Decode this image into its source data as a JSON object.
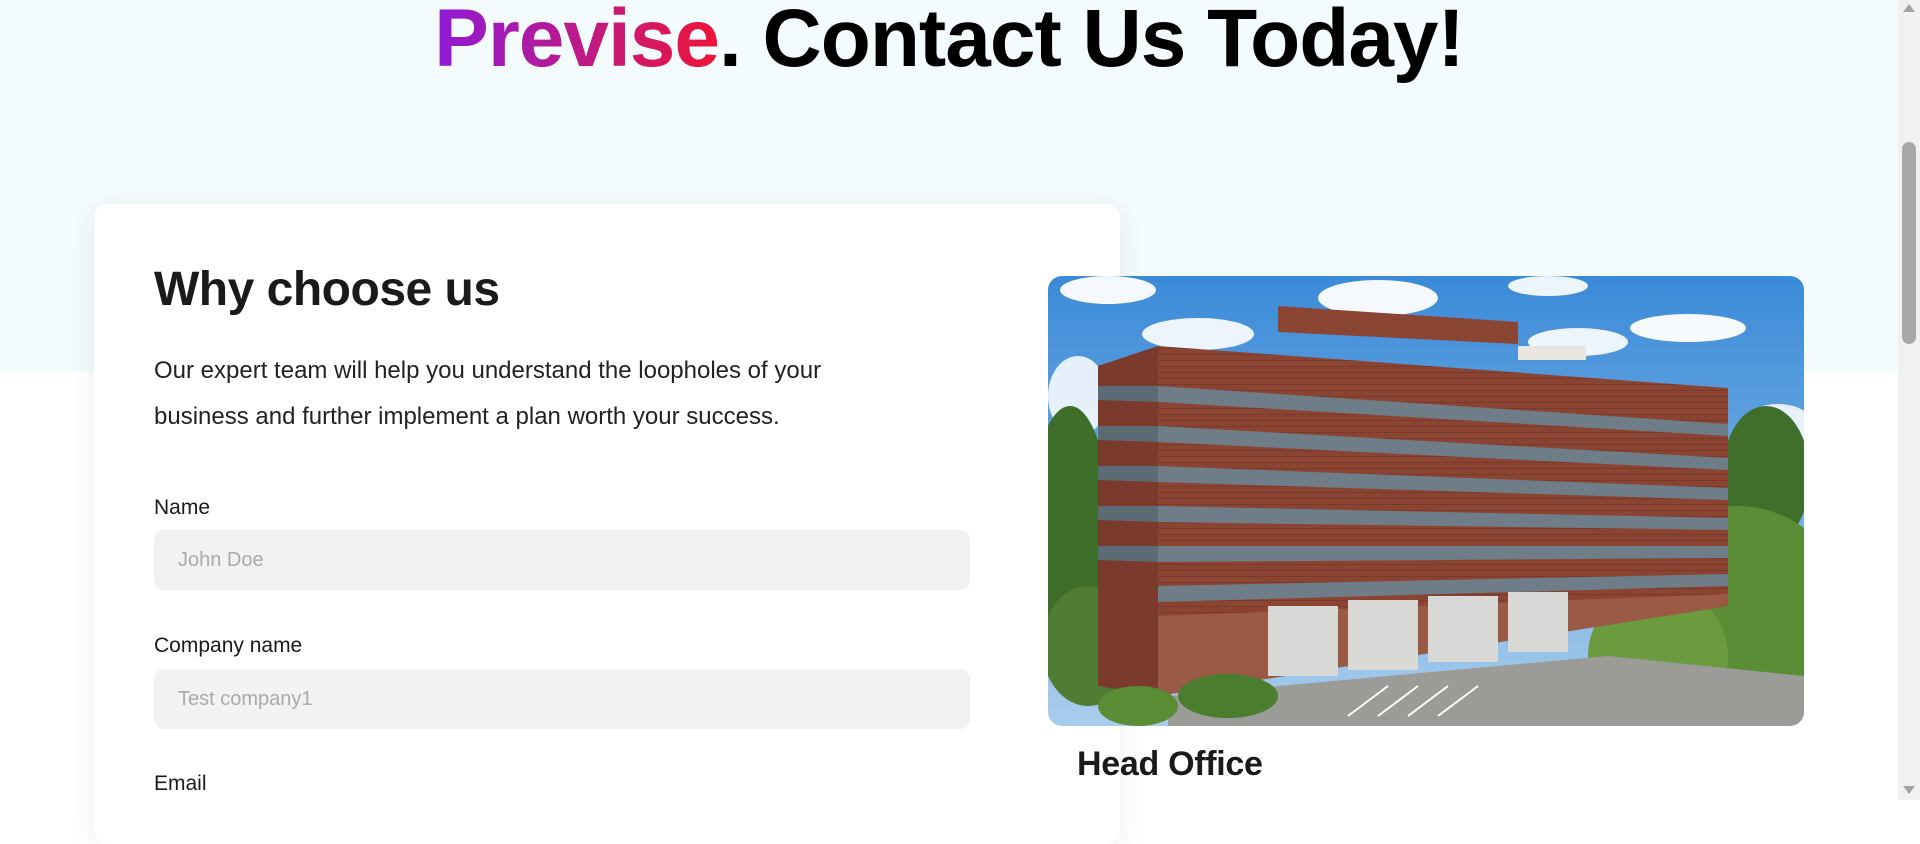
{
  "hero": {
    "brand": "Previse",
    "title_rest": ". Contact Us Today!",
    "gradient_colors": [
      "#8e1ad6",
      "#c11a83",
      "#ee1436"
    ],
    "background_color": "#f3fbfd"
  },
  "why_choose": {
    "title": "Why choose us",
    "text": "Our expert team will help you understand the loopholes of your business and further implement a plan worth your success."
  },
  "form": {
    "name": {
      "label": "Name",
      "placeholder": "John Doe",
      "value": ""
    },
    "company": {
      "label": "Company name",
      "placeholder": "Test company1",
      "value": ""
    },
    "email": {
      "label": "Email"
    }
  },
  "office": {
    "title": "Head Office",
    "image_description": "brick-office-building-photo"
  },
  "scrollbar": {
    "icons": [
      "scroll-up-arrow-icon",
      "scroll-down-arrow-icon"
    ]
  }
}
